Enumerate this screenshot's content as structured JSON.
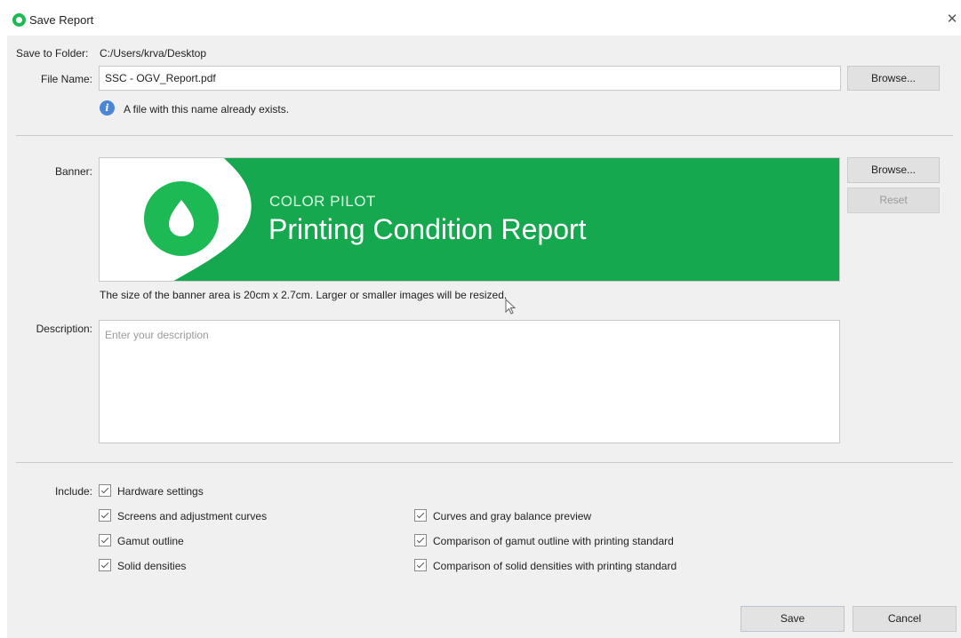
{
  "window": {
    "title": "Save Report",
    "close_glyph": "✕"
  },
  "save_to_folder": {
    "label": "Save to Folder:",
    "value": "C:/Users/krva/Desktop"
  },
  "file_name": {
    "label": "File Name:",
    "value": "SSC - OGV_Report.pdf",
    "browse_label": "Browse...",
    "info_message": "A file with this name already exists."
  },
  "banner": {
    "label": "Banner:",
    "image_subtitle": "COLOR PILOT",
    "image_title": "Printing Condition Report",
    "browse_label": "Browse...",
    "reset_label": "Reset",
    "size_note": "The size of the banner area is 20cm x 2.7cm. Larger or smaller images will be resized.",
    "accent_color": "#16a84e"
  },
  "description": {
    "label": "Description:",
    "placeholder": "Enter your description"
  },
  "include": {
    "label": "Include:",
    "left_items": [
      {
        "label": "Hardware settings",
        "checked": true
      },
      {
        "label": "Screens and adjustment curves",
        "checked": true
      },
      {
        "label": "Gamut outline",
        "checked": true
      },
      {
        "label": "Solid densities",
        "checked": true
      }
    ],
    "right_items": [
      {
        "label": "Curves and gray balance preview",
        "checked": true
      },
      {
        "label": "Comparison of gamut outline with printing standard",
        "checked": true
      },
      {
        "label": "Comparison of solid densities with printing standard",
        "checked": true
      }
    ]
  },
  "footer": {
    "save_label": "Save",
    "cancel_label": "Cancel"
  }
}
